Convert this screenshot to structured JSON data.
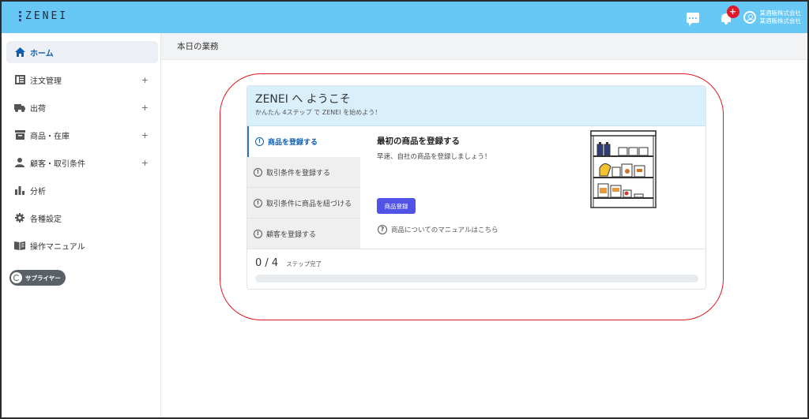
{
  "app": {
    "logo_text": "ZENEI",
    "notification_count": "+",
    "account_line1": "某酒販株式会社",
    "account_line2": "某酒販株式会社"
  },
  "sidebar": {
    "items": [
      {
        "label": "ホーム",
        "icon": "home-icon",
        "active": true
      },
      {
        "label": "注文管理",
        "icon": "orders-icon",
        "expandable": "+"
      },
      {
        "label": "出荷",
        "icon": "truck-icon",
        "expandable": "+"
      },
      {
        "label": "商品・在庫",
        "icon": "archive-icon",
        "expandable": "+"
      },
      {
        "label": "顧客・取引条件",
        "icon": "person-icon",
        "expandable": "+"
      },
      {
        "label": "分析",
        "icon": "bar-chart-icon"
      },
      {
        "label": "各種設定",
        "icon": "gear-icon"
      },
      {
        "label": "操作マニュアル",
        "icon": "book-icon"
      }
    ],
    "supplier_button": "サプライヤー"
  },
  "main": {
    "header_title": "本日の業務",
    "welcome": {
      "title": "ZENEI へ ようこそ",
      "subtitle": "かんたん 4ステップ で ZENEI を始めよう！"
    },
    "steps": [
      {
        "label": "商品を登録する",
        "active": true
      },
      {
        "label": "取引条件を登録する"
      },
      {
        "label": "取引条件に商品を紐づける"
      },
      {
        "label": "顧客を登録する"
      }
    ],
    "step_icon_glyph": "!",
    "content": {
      "title": "最初の商品を登録する",
      "description": "早速、自社の商品を登録しましょう！",
      "button_label": "商品登録",
      "manual_icon_glyph": "?",
      "manual_link": "商品についてのマニュアルはこちら"
    },
    "progress": {
      "count": "0 / 4",
      "label": "ステップ完了",
      "fraction": 0
    }
  },
  "colors": {
    "topbar": "#67c8f5",
    "accent": "#0d5fb0",
    "button": "#5153e6",
    "highlight": "#e0191e",
    "card_header": "#d9effb"
  }
}
